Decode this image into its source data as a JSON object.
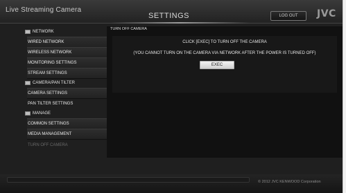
{
  "header": {
    "app_title": "Live Streaming Camera",
    "page_title": "SETTINGS",
    "logout_label": "LOG OUT",
    "brand": "JVC"
  },
  "sidebar": {
    "groups": [
      {
        "label": "NETWORK",
        "icon": "folder-icon"
      },
      {
        "label": "CAMERA/PAN TILTER",
        "icon": "folder-icon"
      },
      {
        "label": "MANAGE",
        "icon": "folder-icon"
      }
    ],
    "items": [
      {
        "label": "WIRED NETWORK"
      },
      {
        "label": "WIRELESS NETWORK"
      },
      {
        "label": "MONITORING SETTINGS"
      },
      {
        "label": "STREAM SETTINGS"
      },
      {
        "label": "CAMERA SETTINGS"
      },
      {
        "label": "PAN TILTER SETTINGS"
      },
      {
        "label": "COMMON SETTINGS"
      },
      {
        "label": "MEDIA MANAGEMENT"
      },
      {
        "label": "TURN OFF CAMERA"
      }
    ],
    "active_item": "TURN OFF CAMERA"
  },
  "main": {
    "heading": "TURN OFF CAMERA",
    "instruction": "CLICK [EXEC] TO TURN OFF THE CAMERA",
    "warning": "(YOU CANNOT TURN ON THE CAMERA VIA NETWORK AFTER THE POWER IS TURNED OFF)",
    "exec_label": "EXEC"
  },
  "footer": {
    "copyright": "© 2012 JVC KENWOOD Corporation"
  },
  "colors": {
    "background": "#1f1f1f",
    "panel": "#111111",
    "active_text": "#6a6a6a",
    "button_face": "#e6e6e6"
  }
}
